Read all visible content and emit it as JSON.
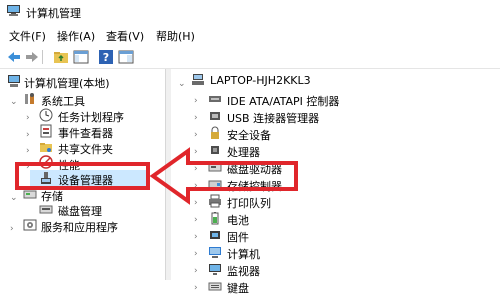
{
  "window": {
    "title": "计算机管理"
  },
  "menu": [
    "文件(F)",
    "操作(A)",
    "查看(V)",
    "帮助(H)"
  ],
  "left_tree": {
    "root": "计算机管理(本地)",
    "system_tools": "系统工具",
    "task_scheduler": "任务计划程序",
    "event_viewer": "事件查看器",
    "shared_folders": "共享文件夹",
    "performance": "性能",
    "device_manager": "设备管理器",
    "storage": "存储",
    "disk_management": "磁盘管理",
    "services_apps": "服务和应用程序"
  },
  "right_tree": {
    "computer": "LAPTOP-HJH2KKL3",
    "items": [
      "IDE ATA/ATAPI 控制器",
      "USB 连接器管理器",
      "安全设备",
      "处理器",
      "磁盘驱动器",
      "存储控制器",
      "打印队列",
      "电池",
      "固件",
      "计算机",
      "监视器",
      "键盘"
    ]
  },
  "colors": {
    "accent_red": "#e0262b",
    "selection": "#cce8ff"
  }
}
